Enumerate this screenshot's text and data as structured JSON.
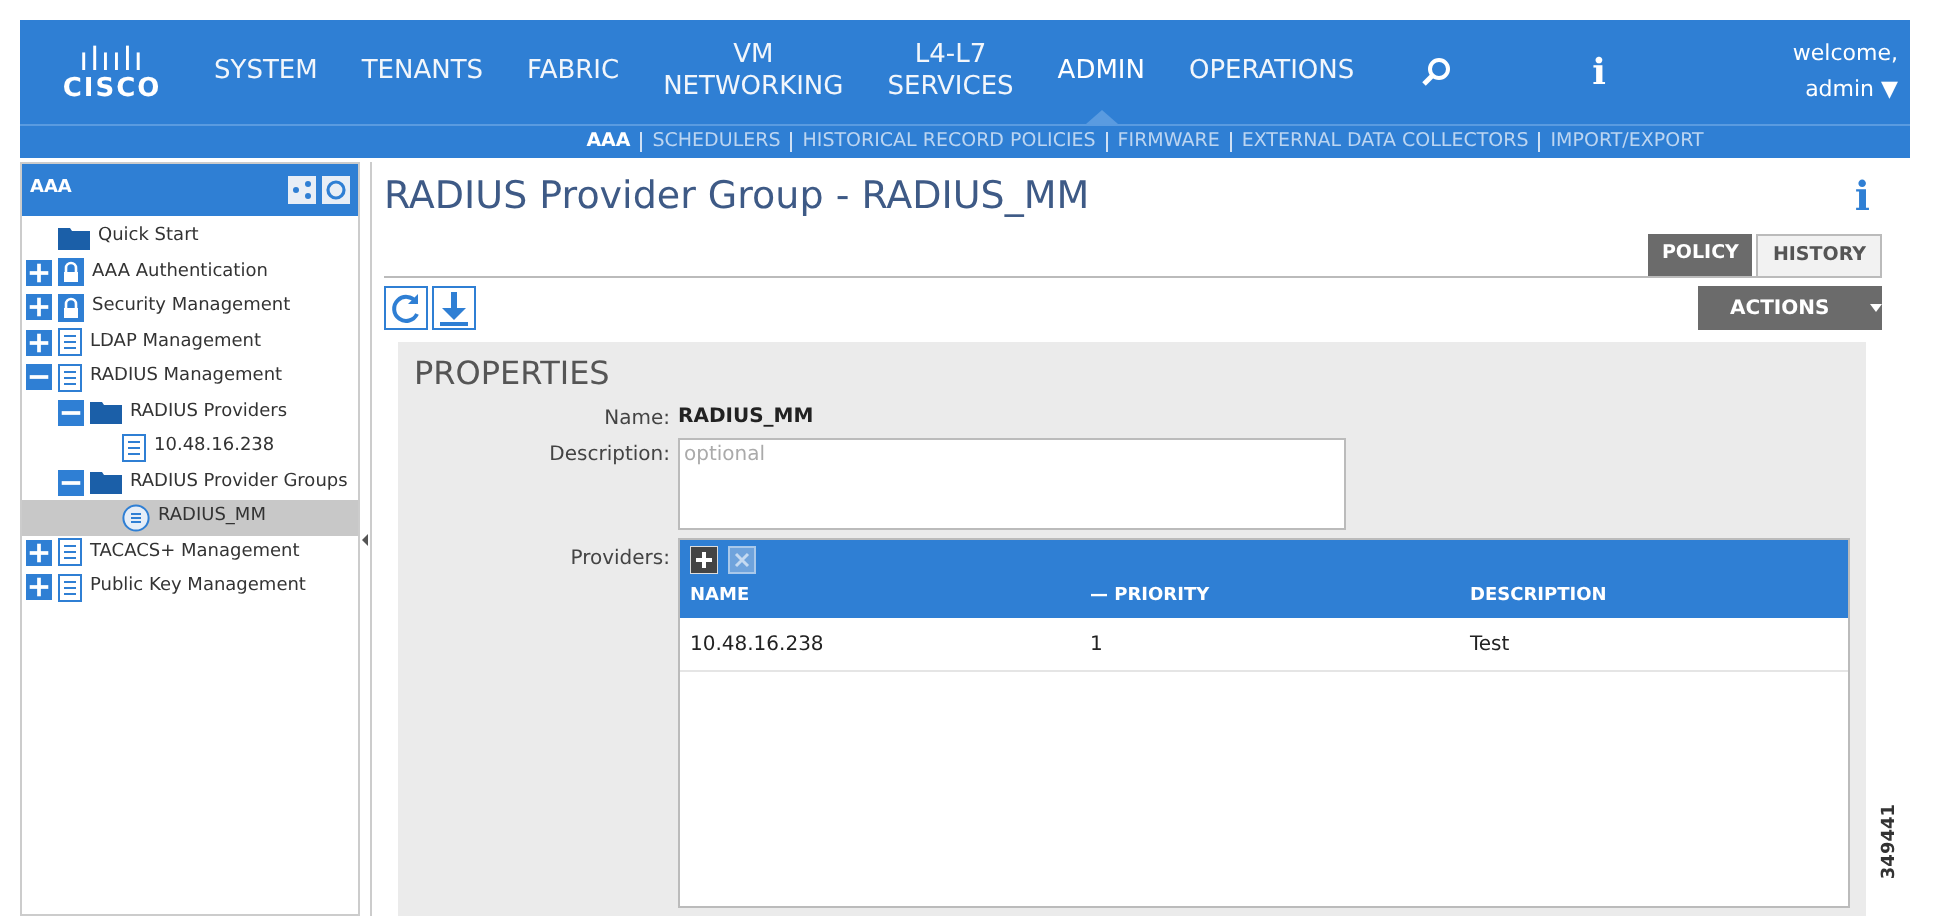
{
  "header": {
    "logo": {
      "mark": "ılıılı",
      "name": "CISCO"
    },
    "nav": [
      {
        "label": "SYSTEM",
        "selected": false
      },
      {
        "label": "TENANTS",
        "selected": false
      },
      {
        "label": "FABRIC",
        "selected": false
      },
      {
        "label": "VM\nNETWORKING",
        "selected": false
      },
      {
        "label": "L4-L7\nSERVICES",
        "selected": false
      },
      {
        "label": "ADMIN",
        "selected": true
      },
      {
        "label": "OPERATIONS",
        "selected": false
      }
    ],
    "info_glyph": "i",
    "welcome": "welcome,",
    "user": "admin ▼"
  },
  "subnav": [
    {
      "label": "AAA",
      "selected": true
    },
    {
      "label": "SCHEDULERS",
      "selected": false
    },
    {
      "label": "HISTORICAL RECORD POLICIES",
      "selected": false
    },
    {
      "label": "FIRMWARE",
      "selected": false
    },
    {
      "label": "EXTERNAL DATA COLLECTORS",
      "selected": false
    },
    {
      "label": "IMPORT/EXPORT",
      "selected": false
    }
  ],
  "sidebar": {
    "title": "AAA",
    "items": [
      {
        "label": "Quick Start",
        "kind": "folder",
        "selected": false
      },
      {
        "label": "AAA Authentication",
        "kind": "lock",
        "expanded": false,
        "selected": false
      },
      {
        "label": "Security Management",
        "kind": "lock",
        "expanded": false,
        "selected": false
      },
      {
        "label": "LDAP Management",
        "kind": "doc",
        "expanded": false,
        "selected": false
      },
      {
        "label": "RADIUS Management",
        "kind": "doc",
        "expanded": true,
        "selected": false,
        "children": [
          {
            "label": "RADIUS Providers",
            "kind": "folder",
            "expanded": true,
            "selected": false,
            "children": [
              {
                "label": "10.48.16.238",
                "kind": "doc",
                "selected": false
              }
            ]
          },
          {
            "label": "RADIUS Provider Groups",
            "kind": "folder",
            "expanded": true,
            "selected": false,
            "children": [
              {
                "label": "RADIUS_MM",
                "kind": "group",
                "selected": true
              }
            ]
          }
        ]
      },
      {
        "label": "TACACS+ Management",
        "kind": "doc",
        "expanded": false,
        "selected": false
      },
      {
        "label": "Public Key Management",
        "kind": "doc",
        "expanded": false,
        "selected": false
      }
    ]
  },
  "page": {
    "title": "RADIUS Provider Group - RADIUS_MM",
    "info_glyph": "i",
    "tabs": [
      {
        "label": "POLICY",
        "selected": true
      },
      {
        "label": "HISTORY",
        "selected": false
      }
    ],
    "actions": "ACTIONS",
    "section": "PROPERTIES",
    "fields": [
      {
        "label": "Name:",
        "value": "RADIUS_MM"
      },
      {
        "label": "Description:",
        "placeholder": "optional"
      }
    ],
    "providers": {
      "label": "Providers:",
      "columns": [
        "NAME",
        "— PRIORITY",
        "DESCRIPTION"
      ],
      "rows": [
        [
          "10.48.16.238",
          "1",
          "Test"
        ]
      ]
    }
  },
  "figure_number": "349441"
}
